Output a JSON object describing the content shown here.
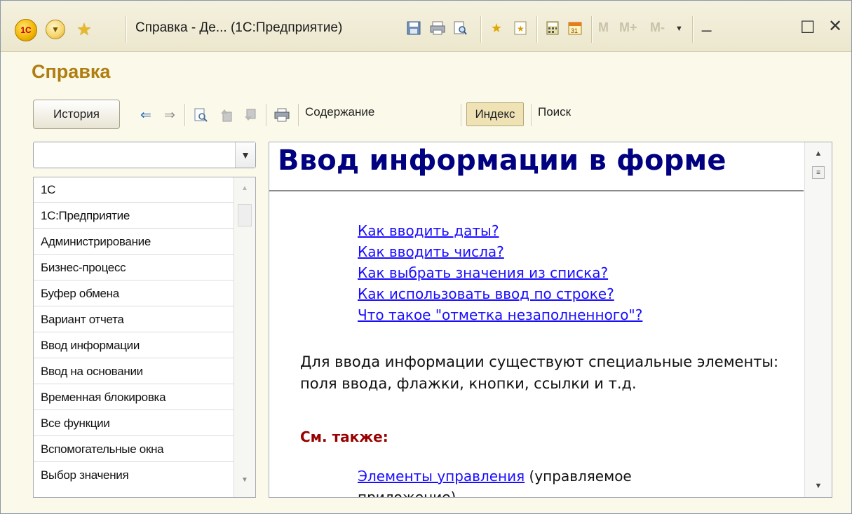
{
  "window": {
    "logo_text": "1С",
    "title": "Справка - Де... (1С:Предприятие)",
    "memory": [
      "M",
      "M+",
      "M-"
    ]
  },
  "page": {
    "heading": "Справка"
  },
  "toolbar": {
    "history_label": "История",
    "contents_label": "Содержание",
    "index_label": "Индекс",
    "search_label": "Поиск"
  },
  "index_combo": {
    "value": ""
  },
  "index_list": [
    "1С",
    "1С:Предприятие",
    "Администрирование",
    "Бизнес-процесс",
    "Буфер обмена",
    "Вариант отчета",
    "Ввод информации",
    "Ввод на основании",
    "Временная блокировка",
    "Все функции",
    "Вспомогательные окна",
    "Выбор значения"
  ],
  "article": {
    "title": "Ввод информации в форме",
    "links": [
      "Как вводить даты?",
      "Как вводить числа?",
      "Как выбрать значения из списка?",
      "Как использовать ввод по строке?",
      "Что такое \"отметка незаполненного\"?"
    ],
    "paragraph": "Для ввода информации существуют специальные элементы: поля ввода, флажки, кнопки, ссылки и т.д.",
    "see_also_label": "См. также:",
    "related_link": "Элементы управления",
    "related_suffix": " (управляемое",
    "related_cut": "приложение)"
  }
}
